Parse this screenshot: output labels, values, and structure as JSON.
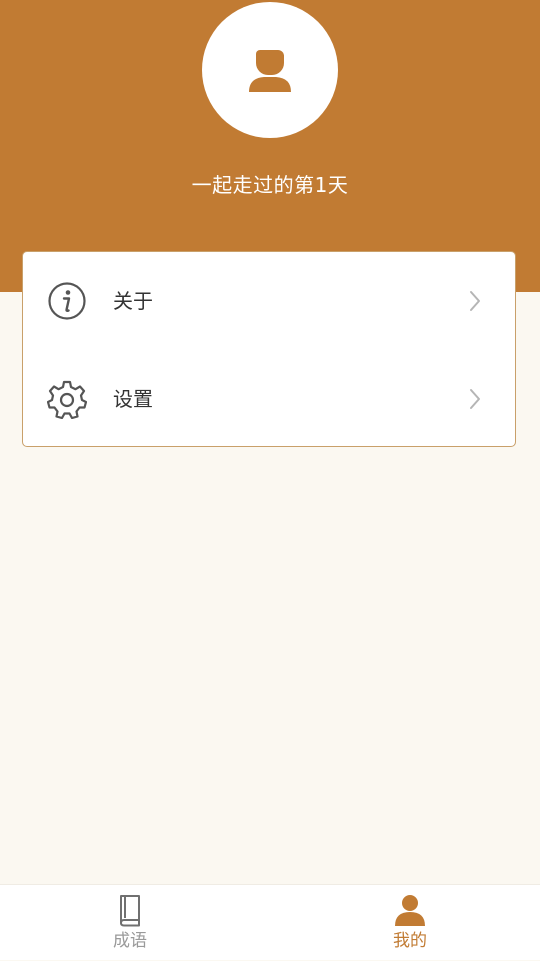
{
  "header": {
    "day_text": "一起走过的第1天",
    "avatar_icon": "user-silhouette-icon"
  },
  "menu": {
    "items": [
      {
        "label": "关于",
        "icon": "info-icon"
      },
      {
        "label": "设置",
        "icon": "gear-icon"
      }
    ]
  },
  "tabbar": {
    "tabs": [
      {
        "label": "成语",
        "icon": "book-icon",
        "active": false
      },
      {
        "label": "我的",
        "icon": "user-icon",
        "active": true
      }
    ]
  },
  "colors": {
    "brand": "#C17B33",
    "background": "#FBF8F1",
    "inactive_tab": "#9A9A9A"
  }
}
